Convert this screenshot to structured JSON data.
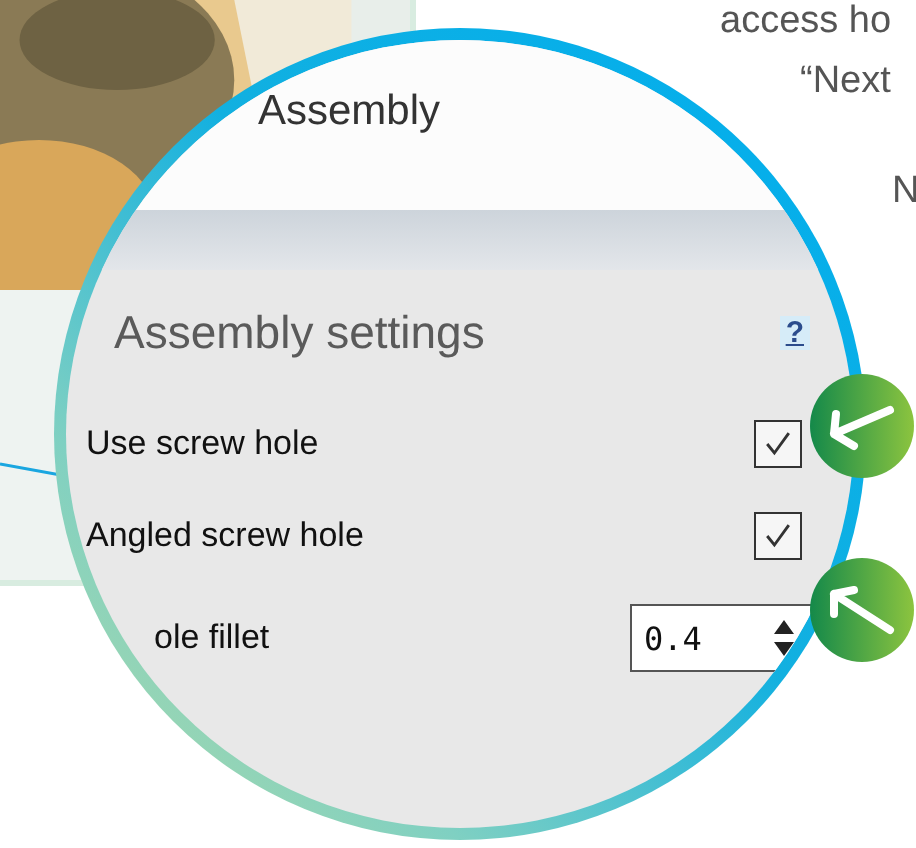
{
  "background_text": [
    "access ho",
    "“Next",
    "N"
  ],
  "magnifier": {
    "panel_title": "Assembly",
    "settings": {
      "title": "Assembly settings",
      "help": "?",
      "rows": [
        {
          "kind": "checkbox",
          "label": "Use screw hole",
          "checked": true
        },
        {
          "kind": "checkbox",
          "label": "Angled screw hole",
          "checked": true
        },
        {
          "kind": "spinner",
          "label": "ole fillet",
          "value": "0.4"
        }
      ]
    }
  }
}
